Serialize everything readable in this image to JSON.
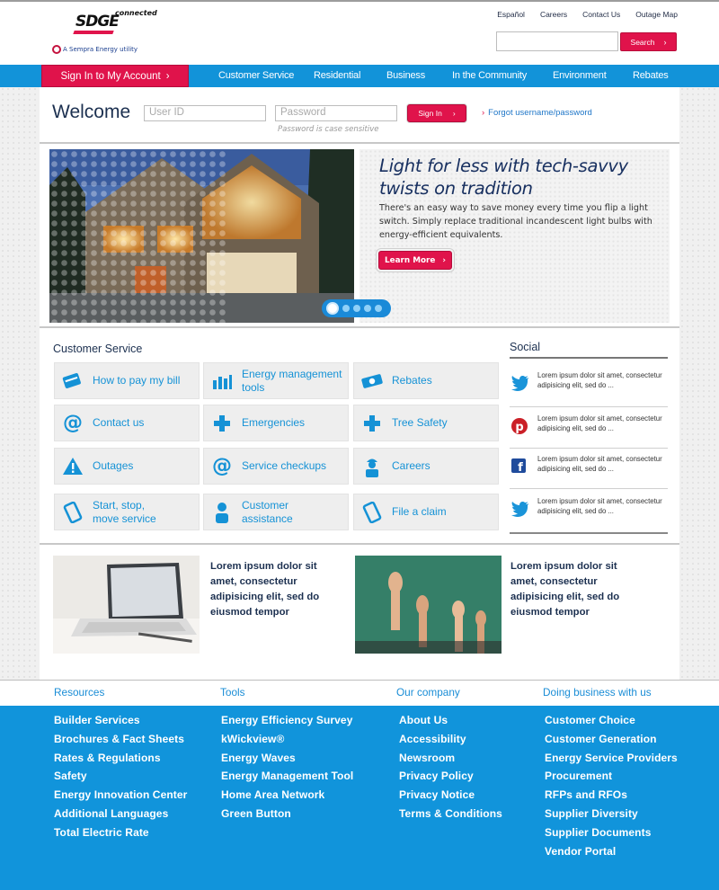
{
  "header": {
    "logo_text": "SDGE",
    "logo_connected": "connected",
    "logo_sempra": "A  Sempra Energy utility",
    "util_links": [
      "Español",
      "Careers",
      "Contact Us",
      "Outage Map"
    ],
    "search_label": "Search",
    "search_placeholder": ""
  },
  "nav": {
    "signin_label": "Sign In to My Account",
    "items": [
      "Customer Service",
      "Residential",
      "Business",
      "In the Community",
      "Environment",
      "Rebates"
    ]
  },
  "login": {
    "welcome": "Welcome",
    "userid_placeholder": "User ID",
    "password_placeholder": "Password",
    "password_hint": "Password is case sensitive",
    "signin_label": "Sign In",
    "forgot_label": "Forgot username/password"
  },
  "hero": {
    "title": "Light for less with tech-savvy twists on tradition",
    "body": "There's an easy way to save money every time you flip a light switch. Simply replace traditional incandescent light bulbs with energy-efficient equivalents.",
    "button_label": "Learn More",
    "slide_count": 5,
    "active_slide": 1
  },
  "customer_service": {
    "title": "Customer Service",
    "tiles": [
      {
        "label": "How to pay my bill",
        "icon": "bill-icon"
      },
      {
        "label": "Energy management tools",
        "icon": "chart-icon"
      },
      {
        "label": "Rebates",
        "icon": "rebate-icon"
      },
      {
        "label": "Contact us",
        "icon": "at-icon"
      },
      {
        "label": "Emergencies",
        "icon": "plus-icon"
      },
      {
        "label": "Tree Safety",
        "icon": "plus-icon"
      },
      {
        "label": "Outages",
        "icon": "warning-icon"
      },
      {
        "label": "Service checkups",
        "icon": "at-icon"
      },
      {
        "label": "Careers",
        "icon": "worker-icon"
      },
      {
        "label": "Start, stop, move service",
        "icon": "phone-icon"
      },
      {
        "label": "Customer assistance",
        "icon": "person-icon"
      },
      {
        "label": "File a claim",
        "icon": "phone-icon"
      }
    ]
  },
  "social": {
    "title": "Social",
    "items": [
      {
        "network": "twitter-icon",
        "text": "Lorem ipsum dolor sit amet, consectetur adipisicing elit, sed do ..."
      },
      {
        "network": "pinterest-icon",
        "text": "Lorem ipsum dolor sit amet, consectetur adipisicing elit, sed do ..."
      },
      {
        "network": "facebook-icon",
        "text": "Lorem ipsum dolor sit amet, consectetur adipisicing elit, sed do ..."
      },
      {
        "network": "twitter-icon",
        "text": "Lorem ipsum dolor sit amet, consectetur adipisicing elit, sed do ..."
      }
    ]
  },
  "promos": [
    {
      "text": "Lorem ipsum dolor sit amet, consectetur adipisicing elit, sed do eiusmod tempor"
    },
    {
      "text": "Lorem ipsum dolor sit amet, consectetur adipisicing elit, sed do eiusmod tempor"
    }
  ],
  "footer": {
    "columns": [
      {
        "title": "Resources",
        "links": [
          "Builder Services",
          "Brochures & Fact Sheets",
          "Rates & Regulations",
          "Safety",
          "Energy Innovation Center",
          "Additional Languages",
          "Total Electric Rate"
        ]
      },
      {
        "title": "Tools",
        "links": [
          "Energy Efficiency Survey",
          "kWickview®",
          "Energy Waves",
          "Energy Management Tool",
          "Home Area Network",
          "Green Button"
        ]
      },
      {
        "title": "Our company",
        "links": [
          "About Us",
          "Accessibility",
          "Newsroom",
          "Privacy Policy",
          "Privacy Notice",
          "Terms & Conditions"
        ]
      },
      {
        "title": "Doing business with us",
        "links": [
          "Customer Choice",
          "Customer Generation",
          "Energy Service Providers",
          "Procurement",
          "RFPs and RFOs",
          "Supplier Diversity",
          "Supplier Documents",
          "Vendor Portal"
        ]
      }
    ]
  },
  "colors": {
    "brand_red": "#e0134b",
    "brand_blue": "#1293d9",
    "navy": "#1c3050"
  }
}
